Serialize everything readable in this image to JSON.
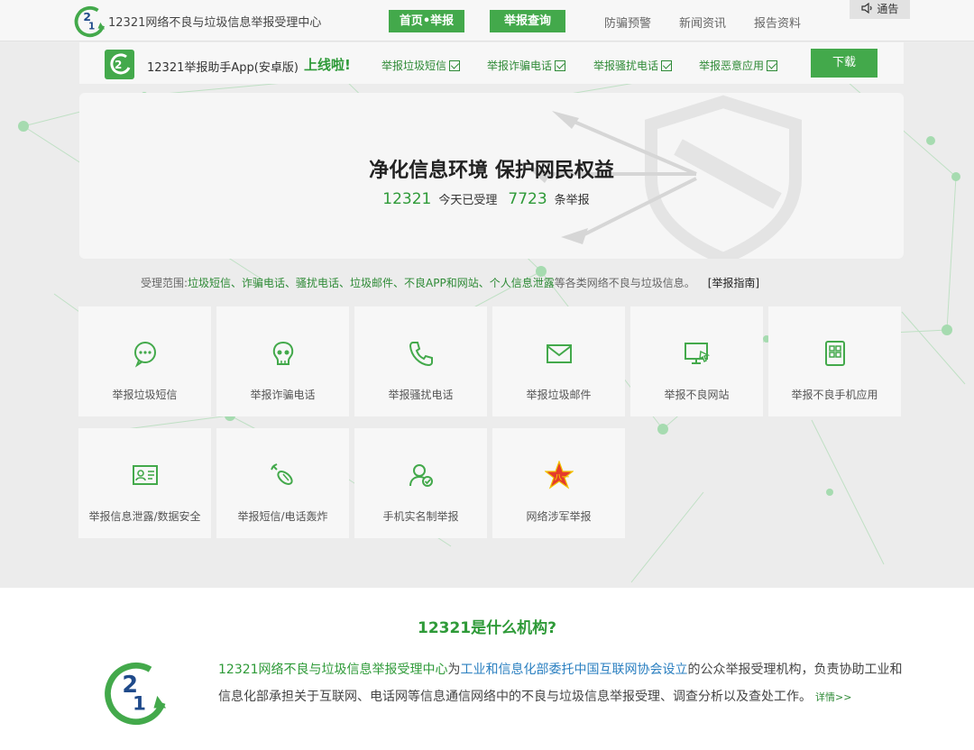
{
  "header": {
    "site_title": "12321网络不良与垃圾信息举报受理中心",
    "nav_home": "首页•举报",
    "nav_query": "举报查询",
    "nav_fraud": "防骗预警",
    "nav_news": "新闻资讯",
    "nav_reports": "报告资料",
    "notice": "通告"
  },
  "appbar": {
    "text": "12321举报助手App(安卓版)",
    "online": "上线啦!",
    "features": [
      "举报垃圾短信",
      "举报诈骗电话",
      "举报骚扰电话",
      "举报恶意应用"
    ],
    "download": "下载"
  },
  "hero": {
    "slogan": "净化信息环境 保护网民权益",
    "stat_number_1": "12321",
    "stat_label_1": "今天已受理",
    "stat_number_2": "7723",
    "stat_label_2": "条举报"
  },
  "scope": {
    "prefix": "受理范围:",
    "items": "垃圾短信、诈骗电话、骚扰电话、垃圾邮件、不良APP和网站、个人信息泄露",
    "suffix": "等各类网络不良与垃圾信息。",
    "guide": "[举报指南]"
  },
  "tiles": [
    {
      "label": "举报垃圾短信",
      "icon": "chat-bubble-icon"
    },
    {
      "label": "举报诈骗电话",
      "icon": "skull-icon"
    },
    {
      "label": "举报骚扰电话",
      "icon": "phone-icon"
    },
    {
      "label": "举报垃圾邮件",
      "icon": "envelope-icon"
    },
    {
      "label": "举报不良网站",
      "icon": "monitor-icon"
    },
    {
      "label": "举报不良手机应用",
      "icon": "mobile-app-icon"
    },
    {
      "label": "举报信息泄露/数据安全",
      "icon": "id-card-icon"
    },
    {
      "label": "举报短信/电话轰炸",
      "icon": "bomb-icon"
    },
    {
      "label": "手机实名制举报",
      "icon": "user-check-icon"
    },
    {
      "label": "网络涉军举报",
      "icon": "army-star-icon"
    }
  ],
  "about": {
    "title": "12321是什么机构?",
    "text_green": "12321网络不良与垃圾信息举报受理中心",
    "text_1": "为",
    "text_blue": "工业和信息化部委托中国互联网协会设立",
    "text_2": "的公众举报受理机构，负责协助工业和信息化部承担关于互联网、电话网等信息通信网络中的不良与垃圾信息举报受理、调查分析以及查处工作。",
    "more": "详情>>"
  },
  "colors": {
    "accent": "#43a94b",
    "accent_dark": "#2e9a38",
    "link_blue": "#2a7fc0"
  }
}
